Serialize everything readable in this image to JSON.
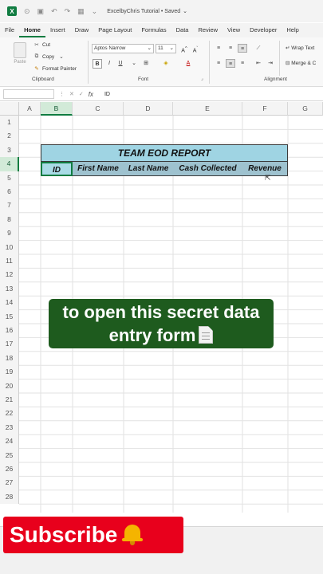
{
  "titlebar": {
    "app_icon": "X",
    "title": "ExcelbyChris Tutorial • Saved"
  },
  "menu": {
    "tabs": [
      "File",
      "Home",
      "Insert",
      "Draw",
      "Page Layout",
      "Formulas",
      "Data",
      "Review",
      "View",
      "Developer",
      "Help"
    ],
    "active": "Home"
  },
  "ribbon": {
    "clipboard": {
      "paste": "Paste",
      "cut": "Cut",
      "copy": "Copy",
      "format_painter": "Format Painter",
      "label": "Clipboard"
    },
    "font": {
      "name": "Aptos Narrow",
      "size": "11",
      "bold": "B",
      "italic": "I",
      "underline": "U",
      "label": "Font"
    },
    "alignment": {
      "wrap_text": "Wrap Text",
      "merge_center": "Merge & C",
      "label": "Alignment"
    }
  },
  "formula_bar": {
    "name_box": "",
    "fx": "fx",
    "value": "ID"
  },
  "grid": {
    "columns": [
      "A",
      "B",
      "C",
      "D",
      "E",
      "F",
      "G"
    ],
    "selected_column": "B",
    "rows": [
      "1",
      "2",
      "3",
      "4",
      "5",
      "6",
      "7",
      "8",
      "9",
      "10",
      "11",
      "12",
      "13",
      "14",
      "15",
      "16",
      "17",
      "18",
      "19",
      "20",
      "21",
      "22",
      "23",
      "24",
      "25",
      "26",
      "27",
      "28"
    ],
    "selected_row": "4"
  },
  "table": {
    "title": "TEAM EOD REPORT",
    "headers": [
      "ID",
      "First Name",
      "Last Name",
      "Cash Collected",
      "Revenue"
    ]
  },
  "caption": {
    "line1": "to open this secret data",
    "line2": "entry form"
  },
  "subscribe": {
    "label": "Subscribe"
  },
  "colors": {
    "excel_green": "#107c41",
    "title_fill": "#9fd4e3",
    "header_fill": "#9ec2cf",
    "caption_bg": "#1e5b1e",
    "subscribe_bg": "#e8001c"
  }
}
